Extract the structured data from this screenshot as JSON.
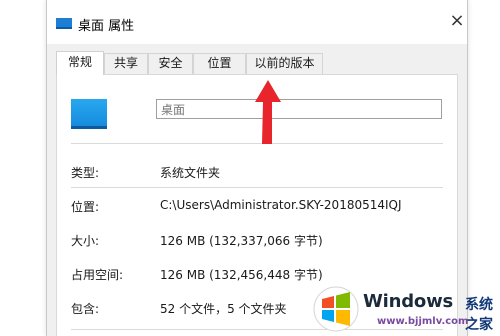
{
  "window": {
    "title": "桌面 属性",
    "close_glyph": "×"
  },
  "tabs": [
    {
      "label": "常规",
      "active": true
    },
    {
      "label": "共享",
      "active": false
    },
    {
      "label": "安全",
      "active": false
    },
    {
      "label": "位置",
      "active": false
    },
    {
      "label": "以前的版本",
      "active": false
    }
  ],
  "general": {
    "folder_icon": "desktop-folder-icon",
    "name_value": "桌面",
    "properties": [
      {
        "label": "类型:",
        "value": "系统文件夹"
      },
      {
        "label": "位置:",
        "value": "C:\\Users\\Administrator.SKY-20180514IQJ"
      },
      {
        "label": "大小:",
        "value": "126 MB (132,337,066 字节)"
      },
      {
        "label": "占用空间:",
        "value": "126 MB (132,456,448 字节)"
      },
      {
        "label": "包含:",
        "value": "52 个文件，5 个文件夹"
      }
    ]
  },
  "annotation": {
    "icon": "red-arrow-icon",
    "color": "#e8242c"
  },
  "watermark": {
    "brand": "Windows",
    "cn_text": "系统之家",
    "url": "www.bjjmlv.com",
    "logo_icon": "windows-logo-icon"
  },
  "colors": {
    "accent": "#1c7fd6",
    "dialog_bg": "#f0f0f0"
  }
}
